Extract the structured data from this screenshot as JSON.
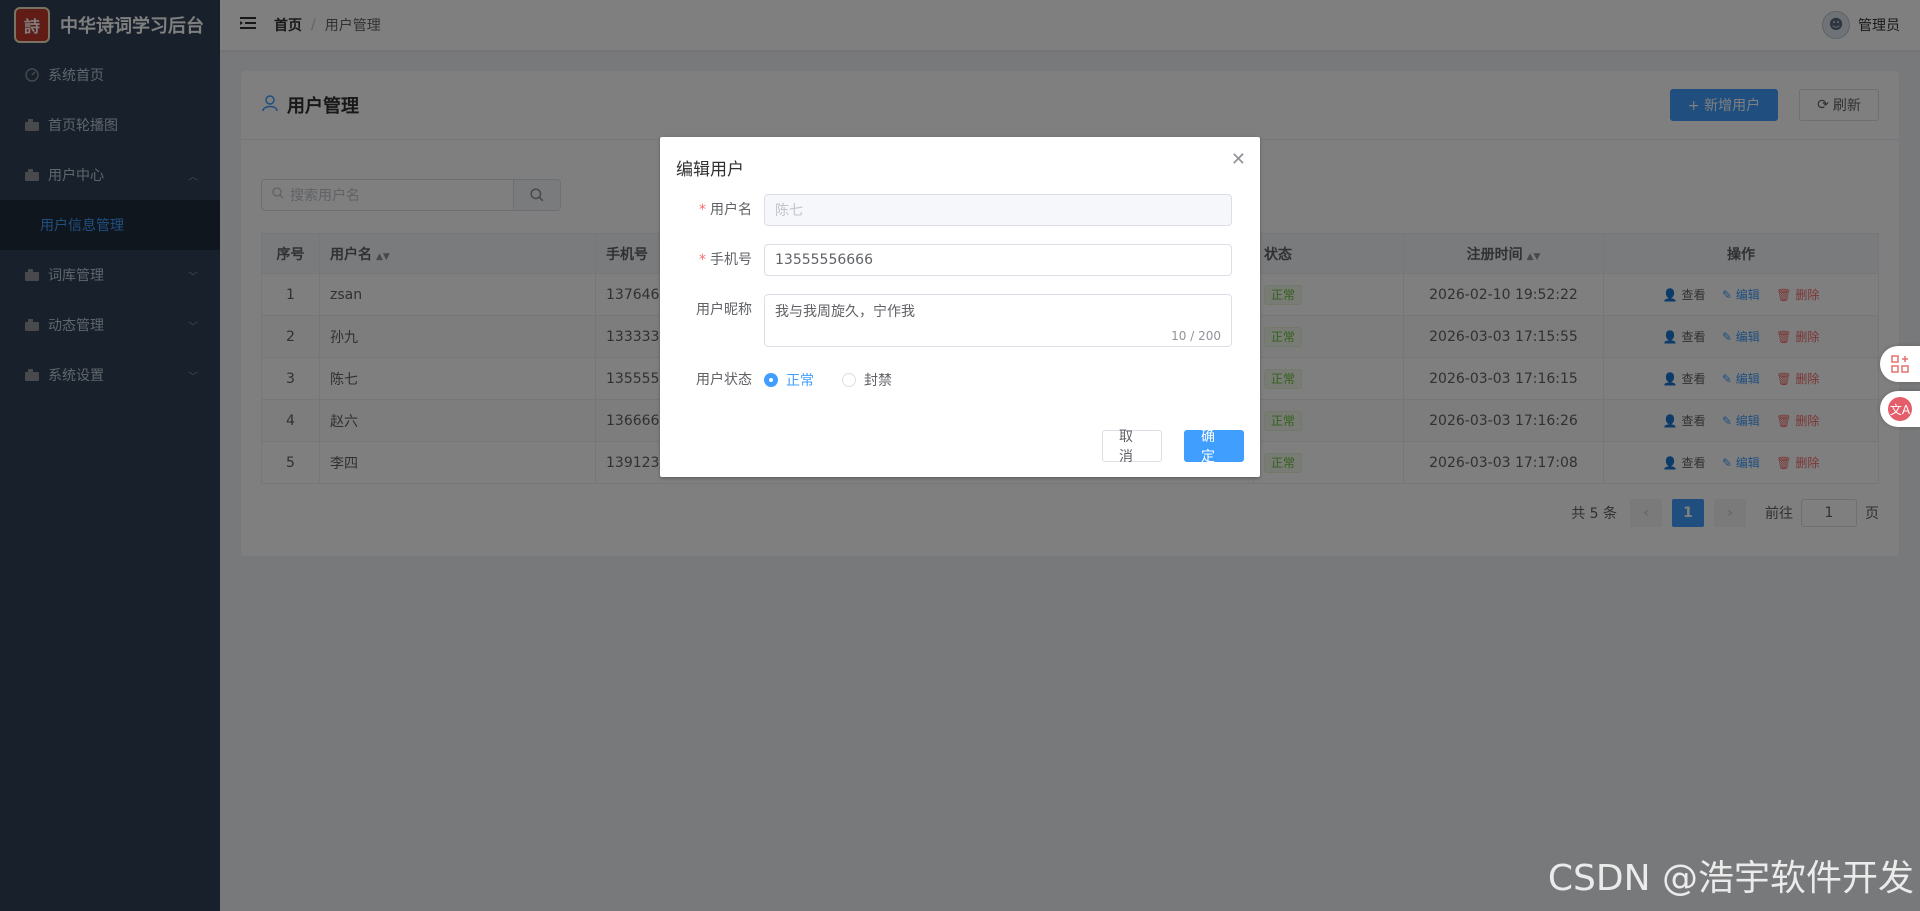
{
  "app": {
    "title": "中华诗词学习后台",
    "logo_text": "詩"
  },
  "sidebar": {
    "items": [
      {
        "label": "系统首页",
        "icon": "dashboard-icon"
      },
      {
        "label": "首页轮播图",
        "icon": "image-icon"
      },
      {
        "label": "用户中心",
        "icon": "user-group-icon",
        "expanded": true,
        "children": [
          {
            "label": "用户信息管理",
            "active": true
          }
        ]
      },
      {
        "label": "词库管理",
        "icon": "book-icon"
      },
      {
        "label": "动态管理",
        "icon": "feed-icon"
      },
      {
        "label": "系统设置",
        "icon": "gear-icon"
      }
    ]
  },
  "header": {
    "breadcrumb": {
      "home": "首页",
      "current": "用户管理"
    },
    "user": {
      "name": "管理员"
    }
  },
  "card": {
    "title": "用户管理",
    "add_button": "+ 新增用户",
    "refresh_button": "刷新"
  },
  "search": {
    "placeholder": "搜索用户名"
  },
  "table": {
    "columns": [
      "序号",
      "用户名",
      "手机号",
      "状态",
      "注册时间",
      "操作"
    ],
    "rows": [
      {
        "idx": "1",
        "username": "zsan",
        "phone": "137646",
        "status": "正常",
        "registered": "2026-02-10 19:52:22"
      },
      {
        "idx": "2",
        "username": "孙九",
        "phone": "133333",
        "status": "正常",
        "registered": "2026-03-03 17:15:55"
      },
      {
        "idx": "3",
        "username": "陈七",
        "phone": "135555",
        "status": "正常",
        "registered": "2026-03-03 17:16:15"
      },
      {
        "idx": "4",
        "username": "赵六",
        "phone": "136666",
        "status": "正常",
        "registered": "2026-03-03 17:16:26"
      },
      {
        "idx": "5",
        "username": "李四",
        "phone": "139123",
        "status": "正常",
        "registered": "2026-03-03 17:17:08"
      }
    ],
    "ops": {
      "view": "查看",
      "edit": "编辑",
      "delete": "删除"
    }
  },
  "pagination": {
    "total": "共 5 条",
    "current": "1",
    "goto": "前往",
    "goto_value": "1",
    "page_unit": "页"
  },
  "dialog": {
    "title": "编辑用户",
    "fields": {
      "username": {
        "label": "用户名",
        "value": "陈七"
      },
      "phone": {
        "label": "手机号",
        "value": "13555556666"
      },
      "nickname": {
        "label": "用户昵称",
        "value": "我与我周旋久，宁作我",
        "counter": "10 / 200"
      },
      "status": {
        "label": "用户状态",
        "options": [
          "正常",
          "封禁"
        ],
        "selected": "正常"
      }
    },
    "cancel": "取消",
    "confirm": "确定"
  },
  "watermark": "CSDN @浩宇软件开发",
  "colors": {
    "sidebar_bg": "#304156",
    "primary": "#409eff",
    "danger": "#f56c6c",
    "success": "#67c23a"
  }
}
